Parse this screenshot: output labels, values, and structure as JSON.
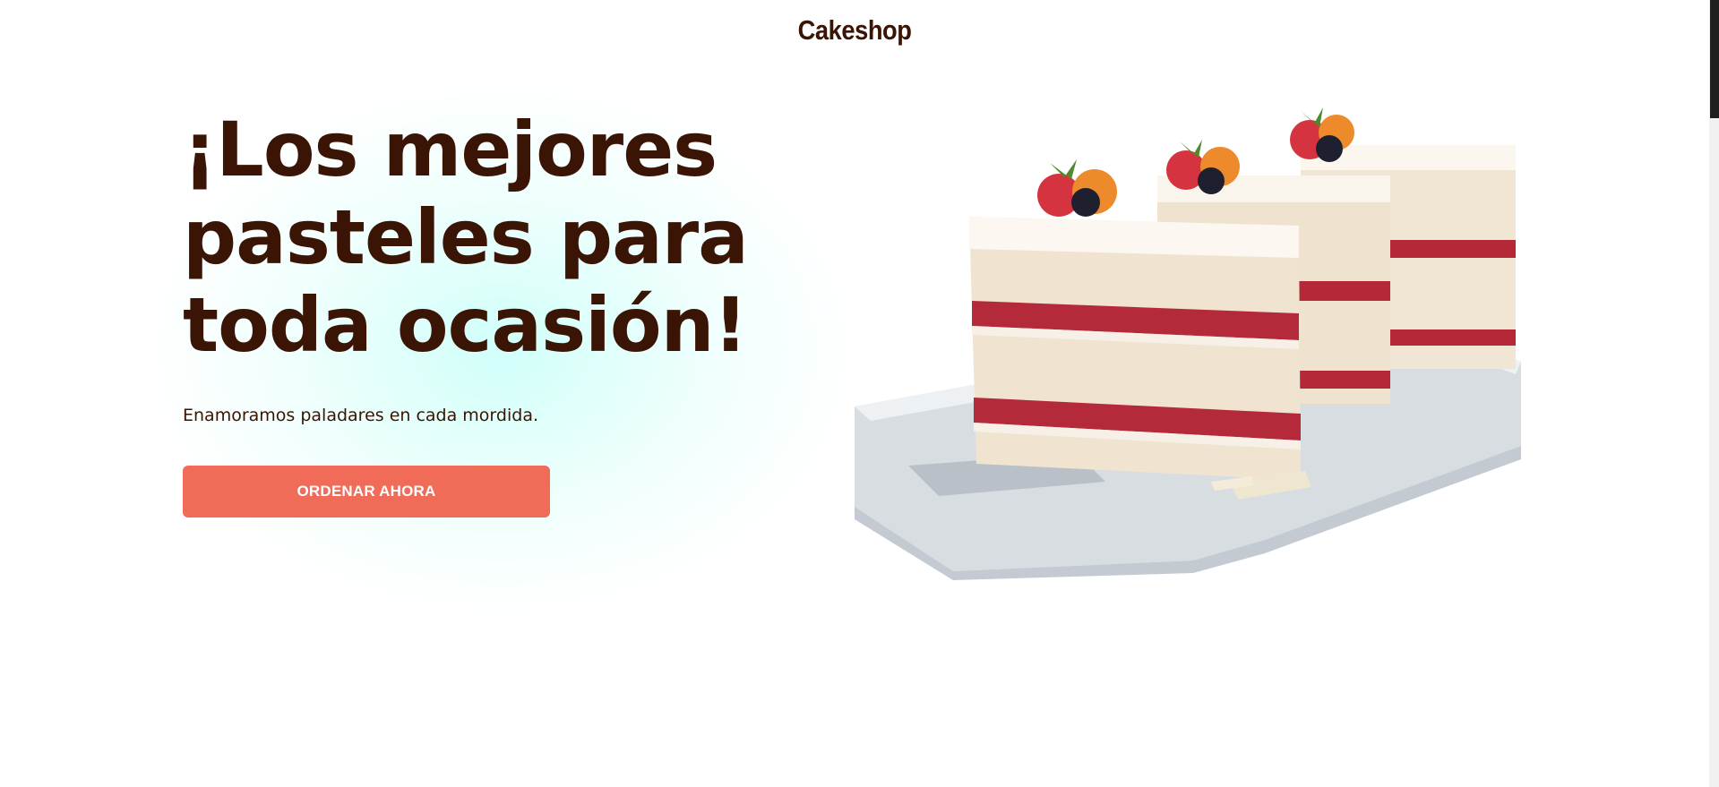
{
  "header": {
    "brand": "Cakeshop"
  },
  "hero": {
    "headline": "¡Los mejores pasteles para toda ocasión!",
    "subtitle": "Enamoramos paladares en cada mordida.",
    "cta_label": "ORDENAR AHORA",
    "image_alt": "layered-cake-slices-photo"
  },
  "colors": {
    "text_brown": "#3a1405",
    "cta_coral": "#f16b59",
    "glow_mint": "#dcfff8",
    "background": "#ffffff"
  }
}
